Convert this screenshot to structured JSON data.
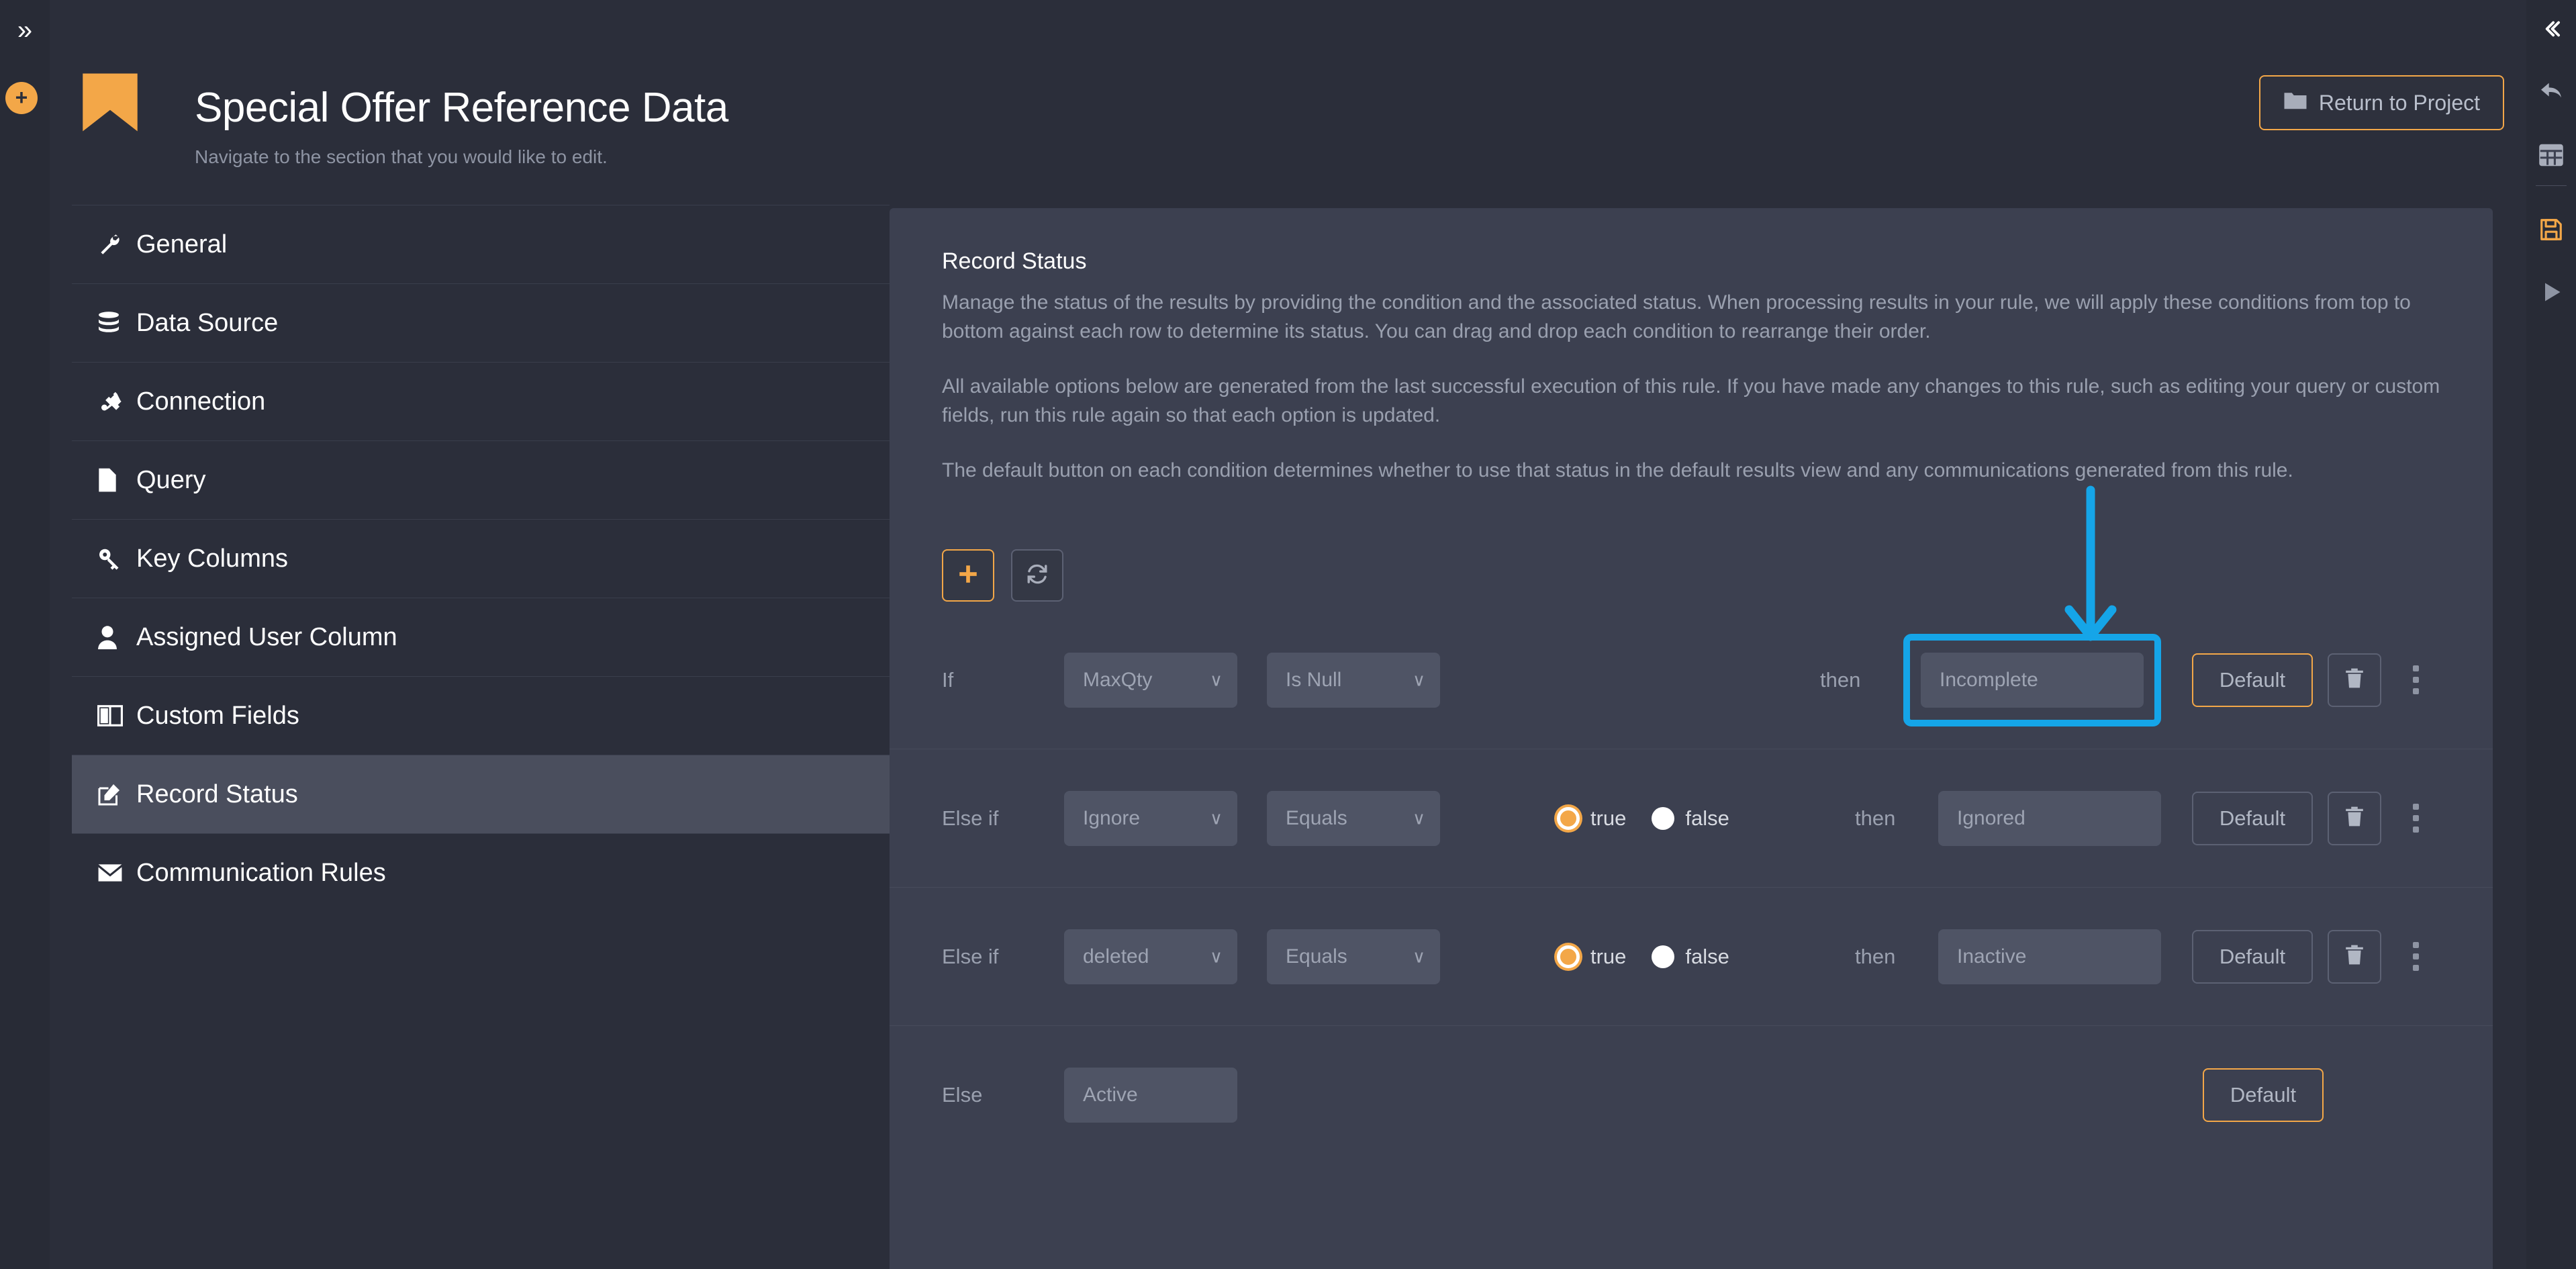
{
  "left_rail": {
    "expand_icon": "chevron-double-right-icon",
    "add_icon": "plus-circle-icon"
  },
  "right_rail": {
    "items": [
      {
        "icon": "chevron-double-left-icon",
        "name": "collapse-panel"
      },
      {
        "icon": "undo-arrow-icon",
        "name": "undo"
      },
      {
        "icon": "table-grid-icon",
        "name": "grid-view"
      },
      {
        "icon": "save-floppy-icon",
        "name": "save",
        "color": "#f3a748"
      },
      {
        "icon": "play-triangle-icon",
        "name": "run"
      }
    ]
  },
  "header": {
    "bookmark_icon": "bookmark-icon",
    "title": "Special Offer Reference Data",
    "subtitle": "Navigate to the section that you would like to edit.",
    "return_button": {
      "label": "Return to Project",
      "icon": "folder-icon"
    }
  },
  "sidebar": {
    "items": [
      {
        "label": "General",
        "icon": "wrench-icon",
        "active": false
      },
      {
        "label": "Data Source",
        "icon": "database-icon",
        "active": false
      },
      {
        "label": "Connection",
        "icon": "plug-icon",
        "active": false
      },
      {
        "label": "Query",
        "icon": "file-icon",
        "active": false
      },
      {
        "label": "Key Columns",
        "icon": "key-icon",
        "active": false
      },
      {
        "label": "Assigned User Column",
        "icon": "user-icon",
        "active": false
      },
      {
        "label": "Custom Fields",
        "icon": "columns-icon",
        "active": false
      },
      {
        "label": "Record Status",
        "icon": "edit-pencil-icon",
        "active": true
      },
      {
        "label": "Communication Rules",
        "icon": "envelope-icon",
        "active": false
      }
    ]
  },
  "panel": {
    "title": "Record Status",
    "paragraphs": [
      "Manage the status of the results by providing the condition and the associated status. When processing results in your rule, we will apply these conditions from top to bottom against each row to determine its status. You can drag and drop each condition to rearrange their order.",
      "All available options below are generated from the last successful execution of this rule. If you have made any changes to this rule, such as editing your query or custom fields, run this rule again so that each option is updated.",
      "The default button on each condition determines whether to use that status in the default results view and any communications generated from this rule."
    ],
    "toolbar": {
      "add_label": "+",
      "add_icon": "plus-icon",
      "refresh_icon": "refresh-sync-icon"
    },
    "labels": {
      "if": "If",
      "else_if": "Else if",
      "else": "Else",
      "then": "then",
      "true": "true",
      "false": "false",
      "default": "Default"
    },
    "conditions": [
      {
        "keyword": "If",
        "field": "MaxQty",
        "operator": "Is Null",
        "has_bool": false,
        "bool_value": null,
        "then_label": "then",
        "status": "Incomplete",
        "default_label": "Default",
        "default_active": true,
        "highlighted": true,
        "delete_icon": "trash-icon",
        "grip_icon": "drag-handle-icon"
      },
      {
        "keyword": "Else if",
        "field": "Ignore",
        "operator": "Equals",
        "has_bool": true,
        "bool_value": "true",
        "then_label": "then",
        "status": "Ignored",
        "default_label": "Default",
        "default_active": false,
        "highlighted": false,
        "delete_icon": "trash-icon",
        "grip_icon": "drag-handle-icon"
      },
      {
        "keyword": "Else if",
        "field": "deleted",
        "operator": "Equals",
        "has_bool": true,
        "bool_value": "true",
        "then_label": "then",
        "status": "Inactive",
        "default_label": "Default",
        "default_active": false,
        "highlighted": false,
        "delete_icon": "trash-icon",
        "grip_icon": "drag-handle-icon"
      }
    ],
    "else_row": {
      "keyword": "Else",
      "status": "Active",
      "default_label": "Default",
      "default_active": true
    }
  },
  "annotation": {
    "arrow_color": "#15a5e8",
    "highlight_color": "#15a5e8",
    "target": "Incomplete"
  },
  "colors": {
    "accent": "#f3a748",
    "panel_bg": "#3c4050",
    "app_bg": "#2b2e3a",
    "rail_bg": "#282b36",
    "input_bg": "#4f5465",
    "annotation_blue": "#15a5e8"
  }
}
